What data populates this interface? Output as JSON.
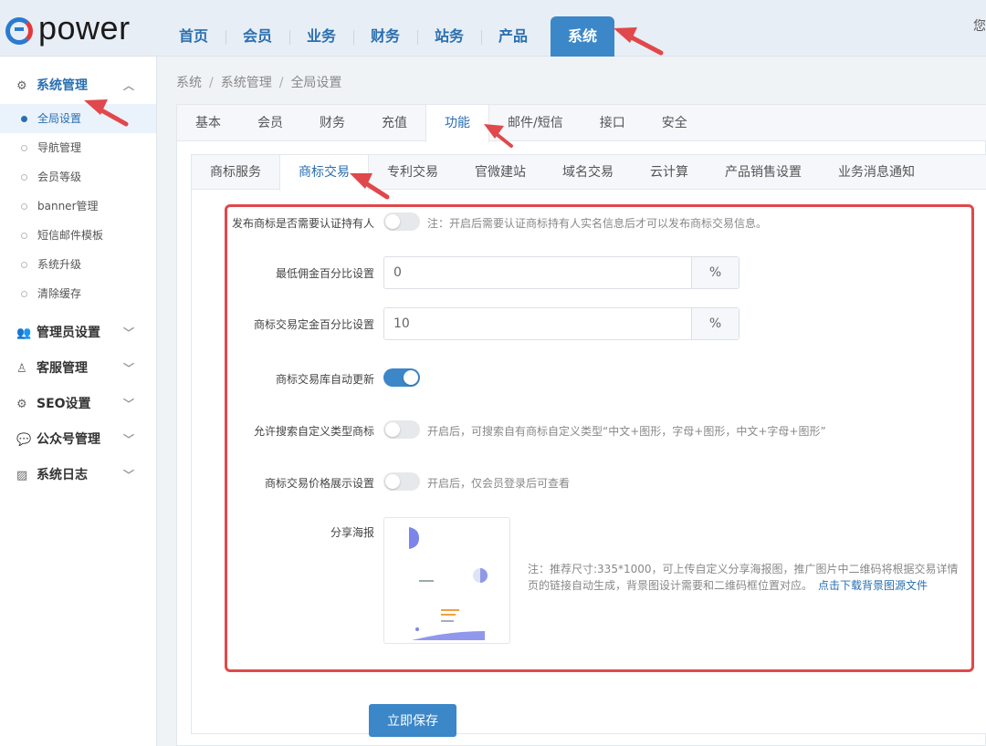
{
  "header": {
    "logo_text": "power",
    "nav": [
      "首页",
      "会员",
      "业务",
      "财务",
      "站务",
      "产品",
      "系统"
    ],
    "active_nav": "系统",
    "right_text": "您"
  },
  "sidebar": {
    "groups": [
      {
        "icon": "gears-icon",
        "label": "系统管理",
        "open": true,
        "items": [
          "全局设置",
          "导航管理",
          "会员等级",
          "banner管理",
          "短信邮件模板",
          "系统升级",
          "清除缓存"
        ],
        "active_item": "全局设置"
      },
      {
        "icon": "users-icon",
        "label": "管理员设置"
      },
      {
        "icon": "support-icon",
        "label": "客服管理"
      },
      {
        "icon": "gear-icon",
        "label": "SEO设置"
      },
      {
        "icon": "wechat-icon",
        "label": "公众号管理"
      },
      {
        "icon": "log-icon",
        "label": "系统日志"
      }
    ]
  },
  "breadcrumb": [
    "系统",
    "系统管理",
    "全局设置"
  ],
  "tabs_main": [
    "基本",
    "会员",
    "财务",
    "充值",
    "功能",
    "邮件/短信",
    "接口",
    "安全"
  ],
  "tabs_main_active": "功能",
  "tabs_sub": [
    "商标服务",
    "商标交易",
    "专利交易",
    "官微建站",
    "域名交易",
    "云计算",
    "产品销售设置",
    "业务消息通知"
  ],
  "tabs_sub_active": "商标交易",
  "form": {
    "require_auth": {
      "label": "发布商标是否需要认证持有人",
      "enabled": false,
      "hint": "注：开启后需要认证商标持有人实名信息后才可以发布商标交易信息。"
    },
    "min_commission": {
      "label": "最低佣金百分比设置",
      "value": "0",
      "unit": "%"
    },
    "deposit_percent": {
      "label": "商标交易定金百分比设置",
      "value": "10",
      "unit": "%"
    },
    "auto_update": {
      "label": "商标交易库自动更新",
      "enabled": true
    },
    "custom_search": {
      "label": "允许搜索自定义类型商标",
      "enabled": false,
      "hint": "开启后，可搜索自有商标自定义类型“中文+图形，字母+图形，中文+字母+图形”"
    },
    "price_display": {
      "label": "商标交易价格展示设置",
      "enabled": false,
      "hint": "开启后，仅会员登录后可查看"
    },
    "share_poster": {
      "label": "分享海报",
      "note": "注：推荐尺寸:335*1000，可上传自定义分享海报图，推广图片中二维码将根据交易详情页的链接自动生成，背景图设计需要和二维码框位置对应。",
      "download_link": "点击下载背景图源文件"
    }
  },
  "save_button": "立即保存",
  "colors": {
    "accent": "#3b87c8",
    "highlight_box": "#e0484b",
    "arrow": "#e0484b"
  }
}
